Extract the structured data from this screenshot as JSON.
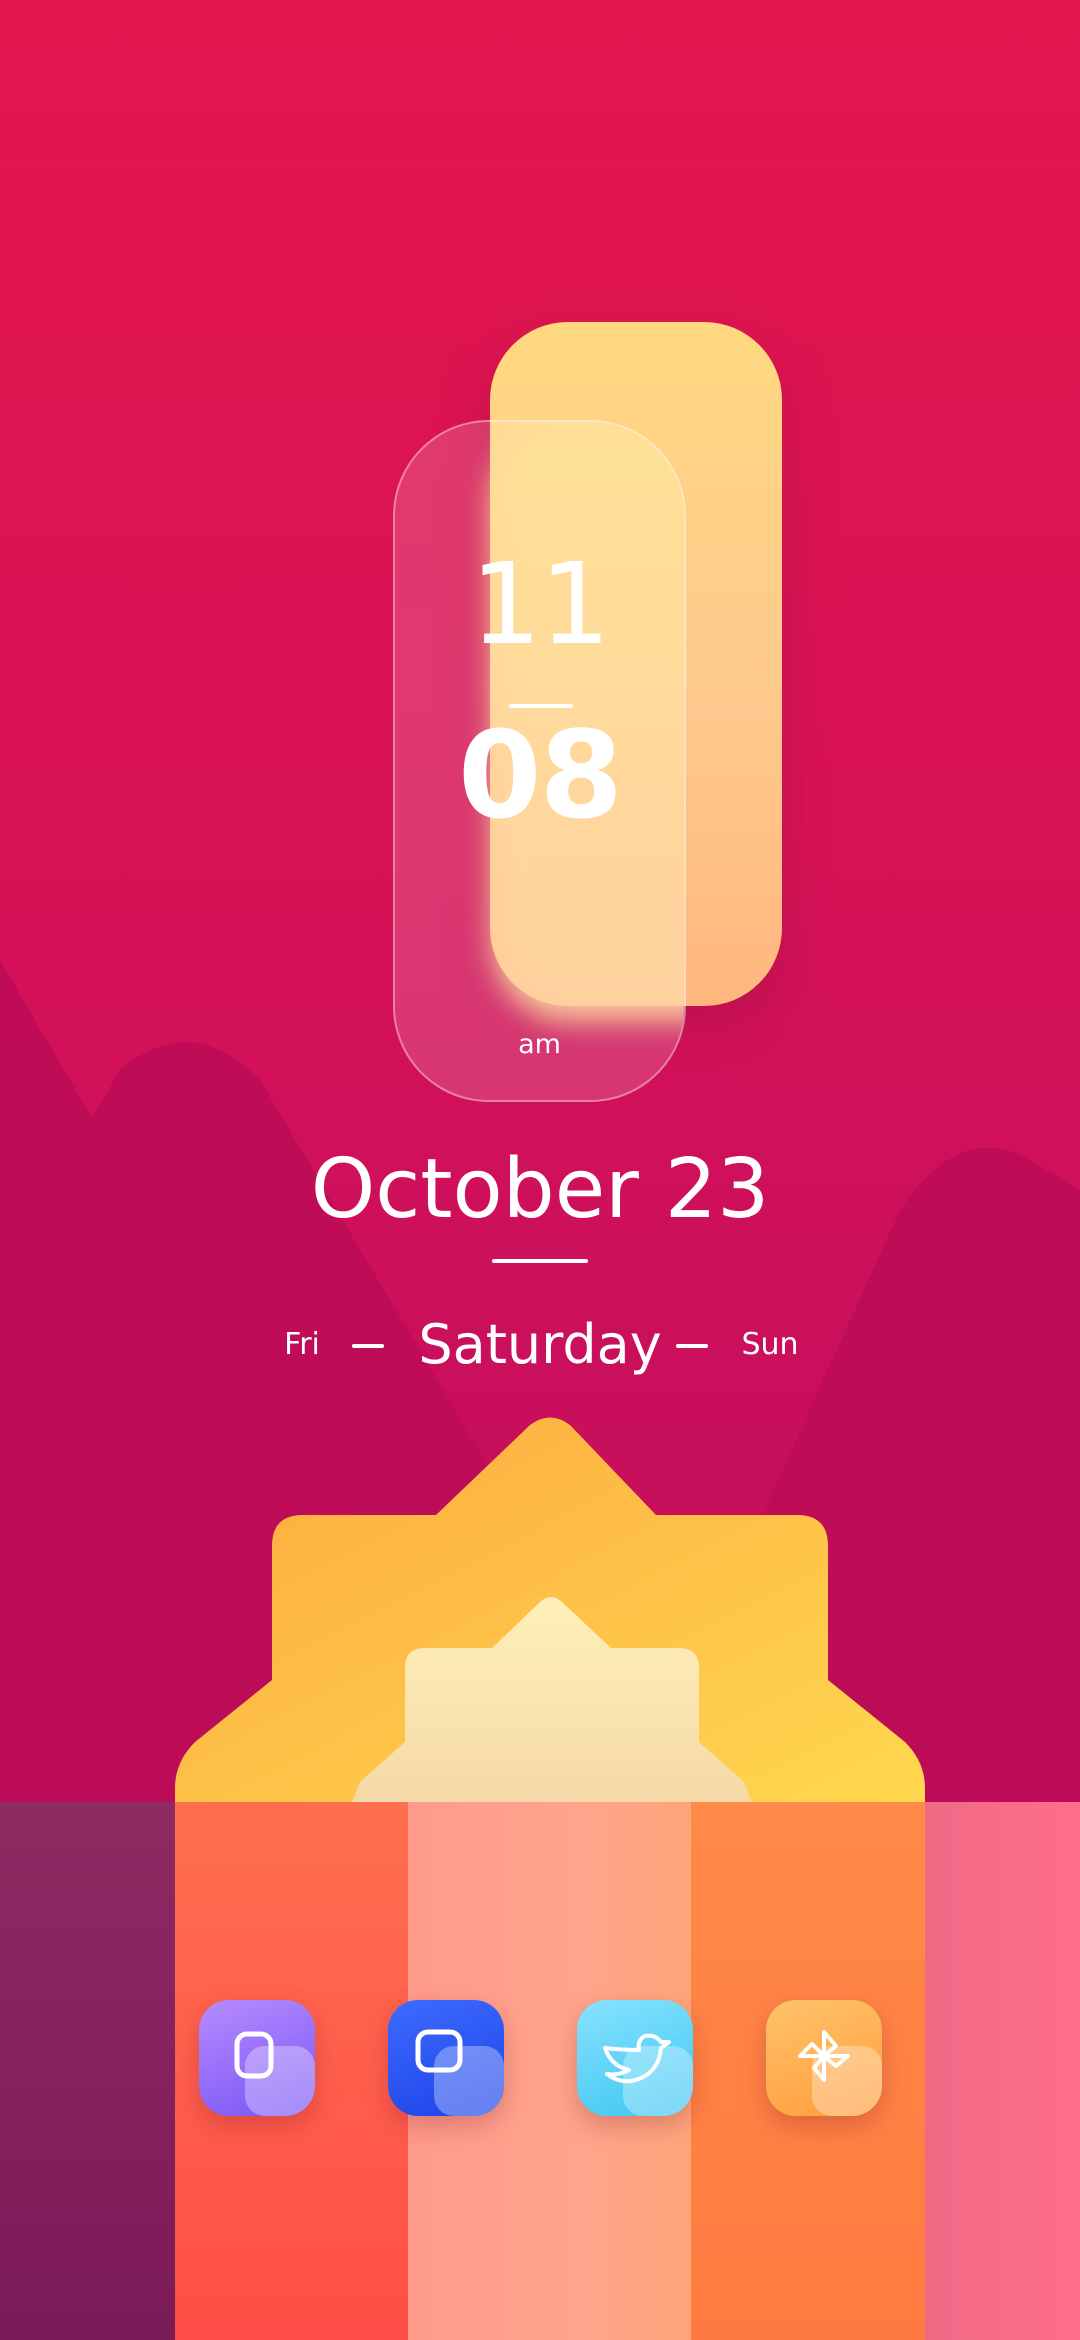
{
  "clock": {
    "hour": "11",
    "minute": "08",
    "period": "am"
  },
  "date": {
    "label": "October 23"
  },
  "days": {
    "previous": "Fri",
    "current": "Saturday",
    "next": "Sun"
  },
  "dock": {
    "apps": [
      {
        "icon": "overlapping-squares-icon",
        "color": "#8f6bff"
      },
      {
        "icon": "overlapping-squares-icon",
        "color": "#2a55f5"
      },
      {
        "icon": "bird-icon",
        "color": "#5cd4f7"
      },
      {
        "icon": "pinwheel-icon",
        "color": "#ffaa4c"
      }
    ]
  },
  "colors": {
    "background": "#d81256",
    "sun": "#fdb944",
    "clock_accent": "#ffd27f"
  }
}
